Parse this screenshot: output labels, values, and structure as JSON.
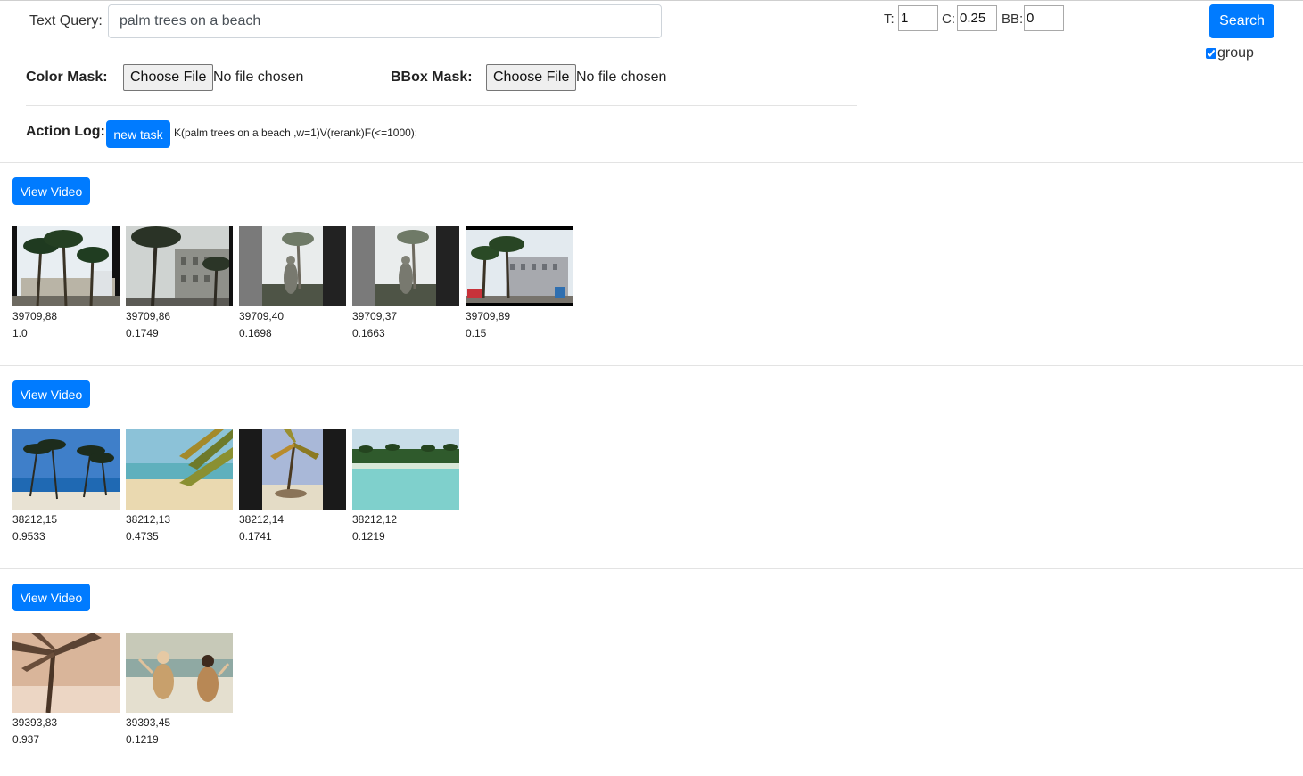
{
  "search": {
    "query_label": "Text Query:",
    "query_value": "palm trees on a beach",
    "t_label": "T:",
    "t_value": "1",
    "c_label": "C:",
    "c_value": "0.25",
    "bb_label": "BB:",
    "bb_value": "0",
    "search_label": "Search",
    "group_label": "group"
  },
  "masks": {
    "color_label": "Color Mask:",
    "color_button": "Choose File",
    "color_status": "No file chosen",
    "bbox_label": "BBox Mask:",
    "bbox_button": "Choose File",
    "bbox_status": "No file chosen"
  },
  "log": {
    "label": "Action Log:",
    "button": "new task",
    "text": "K(palm trees on a beach ,w=1)V(rerank)F(<=1000);"
  },
  "colors": {
    "primary": "#007bff",
    "separator": "#e3e3e3"
  },
  "groups": [
    {
      "button": "View Video",
      "frames": [
        {
          "id": "39709,88",
          "score": "1.0"
        },
        {
          "id": "39709,86",
          "score": "0.1749"
        },
        {
          "id": "39709,40",
          "score": "0.1698"
        },
        {
          "id": "39709,37",
          "score": "0.1663"
        },
        {
          "id": "39709,89",
          "score": "0.15"
        }
      ]
    },
    {
      "button": "View Video",
      "frames": [
        {
          "id": "38212,15",
          "score": "0.9533"
        },
        {
          "id": "38212,13",
          "score": "0.4735"
        },
        {
          "id": "38212,14",
          "score": "0.1741"
        },
        {
          "id": "38212,12",
          "score": "0.1219"
        }
      ]
    },
    {
      "button": "View Video",
      "frames": [
        {
          "id": "39393,83",
          "score": "0.937"
        },
        {
          "id": "39393,45",
          "score": "0.1219"
        }
      ]
    }
  ]
}
